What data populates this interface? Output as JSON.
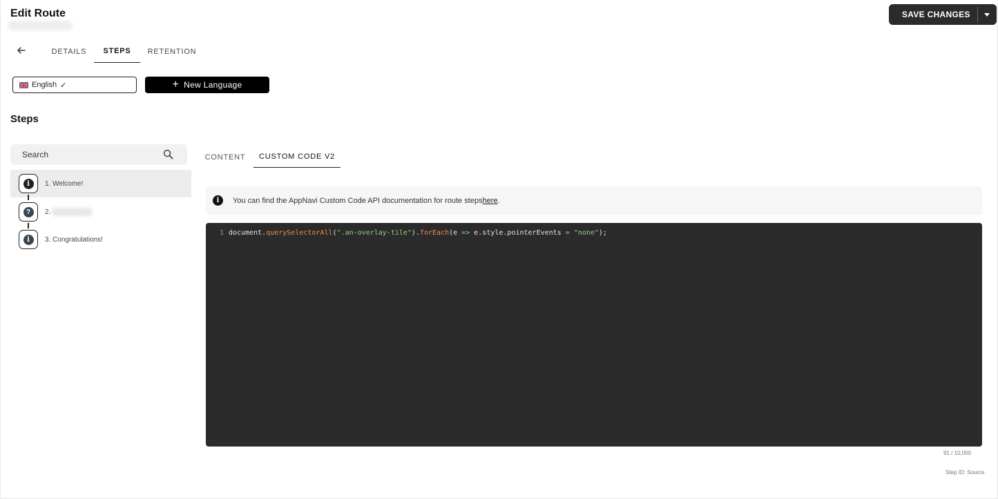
{
  "header": {
    "title": "Edit Route",
    "save_label": "SAVE CHANGES"
  },
  "tabs": [
    {
      "label": "DETAILS"
    },
    {
      "label": "STEPS"
    },
    {
      "label": "RETENTION"
    }
  ],
  "language": {
    "selected": "English",
    "new_label": "New Language"
  },
  "steps_heading": "Steps",
  "search": {
    "placeholder": "Search"
  },
  "steps": [
    {
      "label": "1. Welcome!"
    },
    {
      "label": "2."
    },
    {
      "label": "3. Congratulations!"
    }
  ],
  "sub_tabs": [
    {
      "label": "CONTENT"
    },
    {
      "label": "CUSTOM CODE V2"
    }
  ],
  "info": {
    "text": "You can find the AppNavi Custom Code API documentation for route steps ",
    "link": "here",
    "suffix": "."
  },
  "code": {
    "line_number": "1",
    "tokens": [
      "document.",
      "querySelectorAll",
      "(",
      "\".an-overlay-tile\"",
      ").",
      "forEach",
      "(e ",
      "=>",
      " e.style.pointerEvents ",
      "=",
      " ",
      "\"none\"",
      ");"
    ]
  },
  "char_count": "91 / 10,000",
  "step_id": "Step ID: Source",
  "colors": {
    "primary": "#2b2b2b",
    "editor_bg": "#2b2b2b",
    "code_function": "#f08d49",
    "code_string": "#9bd17a",
    "code_operator": "#7ec8e3"
  }
}
